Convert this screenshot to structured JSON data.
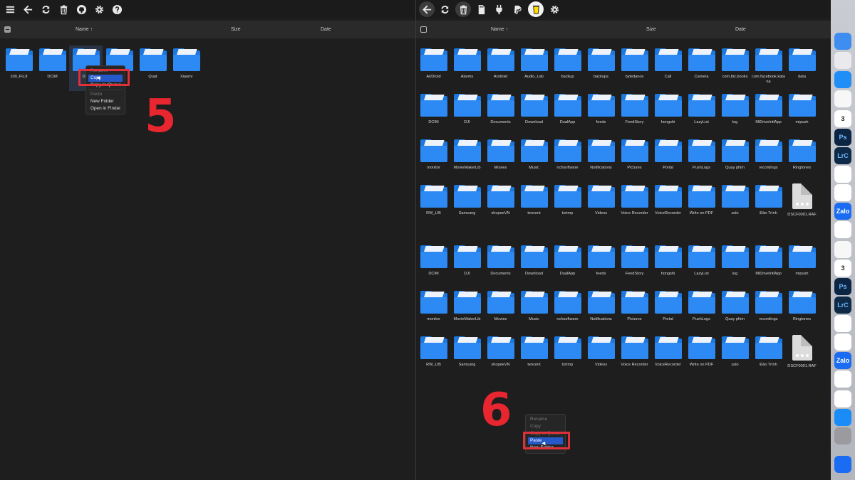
{
  "left_pane": {
    "header": {
      "name": "Name ↑",
      "size": "Size",
      "date": "Date"
    },
    "items": [
      {
        "label": "100_FUJI",
        "kind": "folder"
      },
      {
        "label": "DCIM",
        "kind": "folder"
      },
      {
        "label": "Day",
        "kind": "folder"
      },
      {
        "label": "",
        "kind": "folder"
      },
      {
        "label": "Quat",
        "kind": "folder"
      },
      {
        "label": "Xiaomi",
        "kind": "folder"
      }
    ],
    "context_menu": {
      "items": [
        {
          "label": "Rename",
          "state": "dim"
        },
        {
          "label": "Copy",
          "state": "selected"
        },
        {
          "label": "Copy to Queue",
          "state": "normal"
        },
        {
          "label": "Paste",
          "state": "dim"
        },
        {
          "label": "New Folder",
          "state": "normal"
        },
        {
          "label": "Open in Finder",
          "state": "normal"
        }
      ]
    },
    "step_label": "5"
  },
  "right_pane": {
    "header": {
      "name": "Name ↑",
      "size": "Size",
      "date": "Date"
    },
    "items": [
      {
        "label": "AirDroid",
        "kind": "folder"
      },
      {
        "label": "Alarms",
        "kind": "folder"
      },
      {
        "label": "Android",
        "kind": "folder"
      },
      {
        "label": "Audio_Lab",
        "kind": "folder"
      },
      {
        "label": "backup",
        "kind": "folder"
      },
      {
        "label": "backups",
        "kind": "folder"
      },
      {
        "label": "bytedance",
        "kind": "folder"
      },
      {
        "label": "Call",
        "kind": "folder"
      },
      {
        "label": "Camera",
        "kind": "folder"
      },
      {
        "label": "com.biz.books",
        "kind": "folder"
      },
      {
        "label": "com.facebook.katana",
        "kind": "folder"
      },
      {
        "label": "data",
        "kind": "folder"
      },
      {
        "label": "DCIM",
        "kind": "folder"
      },
      {
        "label": "DJI",
        "kind": "folder"
      },
      {
        "label": "Documents",
        "kind": "folder"
      },
      {
        "label": "Download",
        "kind": "folder"
      },
      {
        "label": "DualApp",
        "kind": "folder"
      },
      {
        "label": "feeds",
        "kind": "folder"
      },
      {
        "label": "FeedStory",
        "kind": "folder"
      },
      {
        "label": "hongshi",
        "kind": "folder"
      },
      {
        "label": "LazyList",
        "kind": "folder"
      },
      {
        "label": "log",
        "kind": "folder"
      },
      {
        "label": "MiDriveIntlApp",
        "kind": "folder"
      },
      {
        "label": "mipush",
        "kind": "folder"
      },
      {
        "label": "monitor",
        "kind": "folder"
      },
      {
        "label": "MovieMakerLib",
        "kind": "folder"
      },
      {
        "label": "Movies",
        "kind": "folder"
      },
      {
        "label": "Music",
        "kind": "folder"
      },
      {
        "label": "nchsoftware",
        "kind": "folder"
      },
      {
        "label": "Notifications",
        "kind": "folder"
      },
      {
        "label": "Pictures",
        "kind": "folder"
      },
      {
        "label": "Portal",
        "kind": "folder"
      },
      {
        "label": "PushLogs",
        "kind": "folder"
      },
      {
        "label": "Quay phim",
        "kind": "folder"
      },
      {
        "label": "recordings",
        "kind": "folder"
      },
      {
        "label": "Ringtones",
        "kind": "folder"
      },
      {
        "label": "RW_LIB",
        "kind": "folder"
      },
      {
        "label": "Samsung",
        "kind": "folder"
      },
      {
        "label": "shopeeVN",
        "kind": "folder"
      },
      {
        "label": "tencent",
        "kind": "folder"
      },
      {
        "label": "txrtmp",
        "kind": "folder"
      },
      {
        "label": "Videos",
        "kind": "folder"
      },
      {
        "label": "Voice Recorder",
        "kind": "folder"
      },
      {
        "label": "VoiceRecorder",
        "kind": "folder"
      },
      {
        "label": "Write on PDF",
        "kind": "folder"
      },
      {
        "label": "zalo",
        "kind": "folder"
      },
      {
        "label": "Đào Trình",
        "kind": "folder"
      },
      {
        "label": "DSCF0001.RAF",
        "kind": "file"
      }
    ],
    "items_repeat": [
      {
        "label": "DCIM",
        "kind": "folder"
      },
      {
        "label": "DJI",
        "kind": "folder"
      },
      {
        "label": "Documents",
        "kind": "folder"
      },
      {
        "label": "Download",
        "kind": "folder"
      },
      {
        "label": "DualApp",
        "kind": "folder"
      },
      {
        "label": "feeds",
        "kind": "folder"
      },
      {
        "label": "FeedStory",
        "kind": "folder"
      },
      {
        "label": "hongshi",
        "kind": "folder"
      },
      {
        "label": "LazyList",
        "kind": "folder"
      },
      {
        "label": "log",
        "kind": "folder"
      },
      {
        "label": "MiDriveIntlApp",
        "kind": "folder"
      },
      {
        "label": "mipush",
        "kind": "folder"
      },
      {
        "label": "monitor",
        "kind": "folder"
      },
      {
        "label": "MovieMakerLib",
        "kind": "folder"
      },
      {
        "label": "Movies",
        "kind": "folder"
      },
      {
        "label": "Music",
        "kind": "folder"
      },
      {
        "label": "nchsoftware",
        "kind": "folder"
      },
      {
        "label": "Notifications",
        "kind": "folder"
      },
      {
        "label": "Pictures",
        "kind": "folder"
      },
      {
        "label": "Portal",
        "kind": "folder"
      },
      {
        "label": "PushLogs",
        "kind": "folder"
      },
      {
        "label": "Quay phim",
        "kind": "folder"
      },
      {
        "label": "recordings",
        "kind": "folder"
      },
      {
        "label": "Ringtones",
        "kind": "folder"
      },
      {
        "label": "RW_LIB",
        "kind": "folder"
      },
      {
        "label": "Samsung",
        "kind": "folder"
      },
      {
        "label": "shopeeVN",
        "kind": "folder"
      },
      {
        "label": "tencent",
        "kind": "folder"
      },
      {
        "label": "txrtmp",
        "kind": "folder"
      },
      {
        "label": "Videos",
        "kind": "folder"
      },
      {
        "label": "Voice Recorder",
        "kind": "folder"
      },
      {
        "label": "VoiceRecorder",
        "kind": "folder"
      },
      {
        "label": "Write on PDF",
        "kind": "folder"
      },
      {
        "label": "zalo",
        "kind": "folder"
      },
      {
        "label": "Đào Trình",
        "kind": "folder"
      },
      {
        "label": "DSCF0001.RAF",
        "kind": "file"
      }
    ],
    "context_menu": {
      "items": [
        {
          "label": "Rename",
          "state": "dim"
        },
        {
          "label": "Copy",
          "state": "dim"
        },
        {
          "label": "Copy to Queue",
          "state": "dim"
        },
        {
          "label": "Paste",
          "state": "selected"
        },
        {
          "label": "New Folder",
          "state": "normal"
        }
      ]
    },
    "step_label": "6"
  },
  "dock": {
    "icons": [
      {
        "name": "finder-icon",
        "color": "#3d8ef0",
        "text": ""
      },
      {
        "name": "launchpad-icon",
        "color": "#e9e9ee",
        "text": ""
      },
      {
        "name": "safari-icon",
        "color": "#1f8ef6",
        "text": ""
      },
      {
        "name": "photos-icon",
        "color": "#f7f7f7",
        "text": ""
      },
      {
        "name": "calendar-icon",
        "color": "#ffffff",
        "text": "3"
      },
      {
        "name": "photoshop-icon",
        "color": "#0b2542",
        "text": "Ps"
      },
      {
        "name": "lightroom-icon",
        "color": "#0e2a47",
        "text": "LrC"
      },
      {
        "name": "capcut-icon",
        "color": "#ffffff",
        "text": ""
      },
      {
        "name": "chrome-icon",
        "color": "#ffffff",
        "text": ""
      },
      {
        "name": "zalo-icon",
        "color": "#1a6cf2",
        "text": "Zalo"
      },
      {
        "name": "reminders-icon",
        "color": "#ffffff",
        "text": ""
      },
      {
        "name": "photos-icon-2",
        "color": "#f7f7f7",
        "text": ""
      },
      {
        "name": "calendar-icon-2",
        "color": "#ffffff",
        "text": "3"
      },
      {
        "name": "photoshop-icon-2",
        "color": "#0b2542",
        "text": "Ps"
      },
      {
        "name": "lightroom-icon-2",
        "color": "#0e2a47",
        "text": "LrC"
      },
      {
        "name": "capcut-icon-2",
        "color": "#ffffff",
        "text": ""
      },
      {
        "name": "chrome-icon-2",
        "color": "#ffffff",
        "text": ""
      },
      {
        "name": "zalo-icon-2",
        "color": "#1a6cf2",
        "text": "Zalo"
      },
      {
        "name": "reminders-icon-2",
        "color": "#ffffff",
        "text": ""
      },
      {
        "name": "freeform-icon",
        "color": "#ffffff",
        "text": ""
      },
      {
        "name": "app-store-icon",
        "color": "#1a8cf7",
        "text": ""
      },
      {
        "name": "system-settings-icon",
        "color": "#9a9a9f",
        "text": ""
      },
      {
        "name": "bluetooth-icon",
        "color": "#1a6cf2",
        "text": ""
      }
    ]
  }
}
